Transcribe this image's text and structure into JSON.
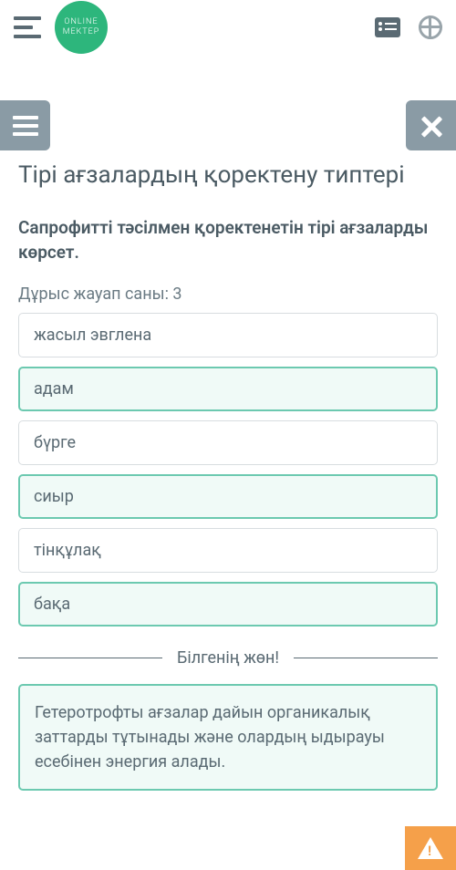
{
  "logo": {
    "line1": "ONLINE",
    "line2": "MEKTEP"
  },
  "title": "Тірі ағзалардың қоректену типтері",
  "question": "Сапрофитті тәсілмен қоректенетін тірі ағзаларды көрсет.",
  "hint": "Дұрыс жауап саны: 3",
  "options": [
    {
      "label": "жасыл эвглена",
      "selected": false
    },
    {
      "label": "адам",
      "selected": true
    },
    {
      "label": "бүрге",
      "selected": false
    },
    {
      "label": "сиыр",
      "selected": true
    },
    {
      "label": "тінқұлақ",
      "selected": false
    },
    {
      "label": "бақа",
      "selected": true
    }
  ],
  "divider_text": "Білгенің жөн!",
  "info_text": "Гетеротрофты ағзалар дайын органикалық заттарды тұтынады және олардың ыдырауы есебінен энергия алады."
}
